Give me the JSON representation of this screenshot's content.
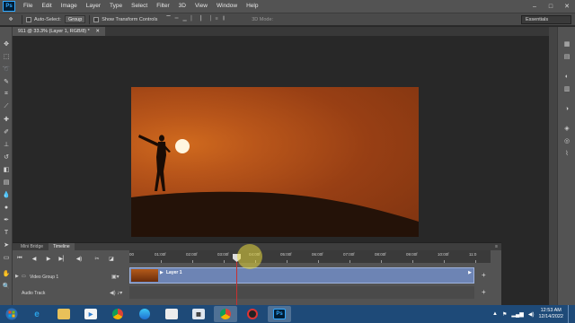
{
  "app": {
    "logo": "Ps",
    "menu": [
      "File",
      "Edit",
      "Image",
      "Layer",
      "Type",
      "Select",
      "Filter",
      "3D",
      "View",
      "Window",
      "Help"
    ],
    "window_controls": [
      "–",
      "□",
      "✕"
    ]
  },
  "options": {
    "auto_select_label": "Auto-Select:",
    "auto_select_value": "Group",
    "transform_label": "Show Transform Controls",
    "mode_3d": "3D Mode:",
    "workspace": "Essentials"
  },
  "document": {
    "tab_title": "911 @ 33.3% (Layer 1, RGB/8) *",
    "close_glyph": "✕"
  },
  "panel": {
    "tabs": [
      "Mini Bridge",
      "Timeline"
    ],
    "active_tab": "Timeline",
    "menu_glyph": "≡"
  },
  "timeline": {
    "ruler_ticks": [
      "00",
      "01:00f",
      "02:00f",
      "03:00f",
      "04:00f",
      "05:00f",
      "06:00f",
      "07:00f",
      "08:00f",
      "09:00f",
      "10:00f",
      "11:0"
    ],
    "video_group_label": "Video Group 1",
    "clip_label": "Layer 1",
    "audio_track_label": "Audio Track",
    "playhead_time": "03:25f"
  },
  "taskbar": {
    "time": "12:53 AM",
    "date": "12/14/2022",
    "apps": [
      "ie-icon",
      "folder-icon",
      "media-player-icon",
      "chrome-icon",
      "edge-icon",
      "files-icon",
      "calendar-icon",
      "chrome-icon",
      "record-icon",
      "photoshop-icon"
    ]
  },
  "colors": {
    "accent": "#31a8ff",
    "clip": "#6d84b4",
    "playhead": "#c83030",
    "highlight": "#e6d73c"
  }
}
